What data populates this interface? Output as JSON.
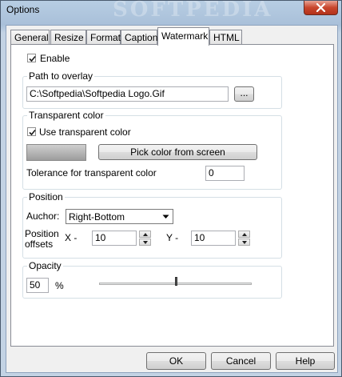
{
  "window": {
    "title": "Options",
    "watermark_text": "SOFTPEDIA"
  },
  "tabs": [
    {
      "label": "General",
      "active": false
    },
    {
      "label": "Resize",
      "active": false
    },
    {
      "label": "Format",
      "active": false
    },
    {
      "label": "Caption",
      "active": false
    },
    {
      "label": "Watermark",
      "active": true
    },
    {
      "label": "HTML",
      "active": false
    }
  ],
  "watermark": {
    "enable_label": "Enable",
    "enable_checked": true,
    "path": {
      "legend": "Path to overlay",
      "value": "C:\\Softpedia\\Softpedia Logo.Gif",
      "browse_label": "..."
    },
    "transparent": {
      "legend": "Transparent color",
      "use_label": "Use transparent color",
      "use_checked": true,
      "pick_label": "Pick color from screen",
      "tolerance_label": "Tolerance for transparent color",
      "tolerance_value": "0"
    },
    "position": {
      "legend": "Position",
      "anchor_label": "Auchor:",
      "anchor_value": "Right-Bottom",
      "offsets_label_1": "Position",
      "offsets_label_2": "offsets",
      "x_label": "X -",
      "x_value": "10",
      "y_label": "Y -",
      "y_value": "10"
    },
    "opacity": {
      "legend": "Opacity",
      "value": "50",
      "unit": "%",
      "slider_fraction": 0.5
    }
  },
  "footer": {
    "ok_label": "OK",
    "cancel_label": "Cancel",
    "help_label": "Help"
  },
  "colors": {
    "titlebar": "#b7cde3",
    "close_button": "#c8462d",
    "panel": "#ffffff",
    "dialog": "#f0f0f0"
  }
}
